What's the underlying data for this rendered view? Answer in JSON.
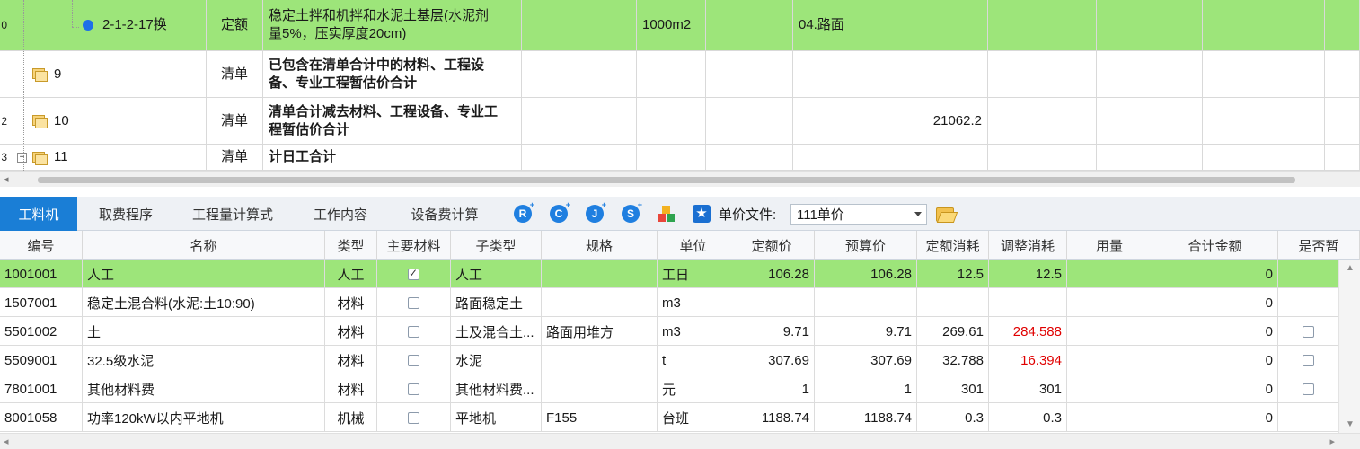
{
  "top_rows": [
    {
      "row_no": "0",
      "code": "2-1-2-17换",
      "type": "定额",
      "name_line1": "稳定土拌和机拌和水泥土基层(水泥剂",
      "name_line2": "量5%，压实厚度20cm)",
      "unit": "1000m2",
      "category": "04.路面",
      "amount": ""
    },
    {
      "row_no": "",
      "code": "9",
      "type": "清单",
      "name_line1": "已包含在清单合计中的材料、工程设",
      "name_line2": "备、专业工程暂估价合计",
      "unit": "",
      "category": "",
      "amount": ""
    },
    {
      "row_no": "2",
      "code": "10",
      "type": "清单",
      "name_line1": "清单合计减去材料、工程设备、专业工",
      "name_line2": "程暂估价合计",
      "unit": "",
      "category": "",
      "amount": "21062.2"
    },
    {
      "row_no": "3",
      "code": "11",
      "type": "清单",
      "name_line1": "计日工合计",
      "name_line2": "",
      "unit": "",
      "category": "",
      "amount": ""
    }
  ],
  "tabs": [
    {
      "label": "工料机",
      "active": true
    },
    {
      "label": "取费程序"
    },
    {
      "label": "工程量计算式"
    },
    {
      "label": "工作内容"
    },
    {
      "label": "设备费计算"
    }
  ],
  "toolbar": {
    "icons": [
      "R",
      "C",
      "J",
      "S"
    ],
    "price_file_label": "单价文件:",
    "price_file_value": "111单价"
  },
  "columns": [
    "编号",
    "名称",
    "类型",
    "主要材料",
    "子类型",
    "规格",
    "单位",
    "定额价",
    "预算价",
    "定额消耗",
    "调整消耗",
    "用量",
    "合计金额",
    "是否暂"
  ],
  "rows": [
    {
      "code": "1001001",
      "name": "人工",
      "type": "人工",
      "main": true,
      "subtype": "人工",
      "spec": "",
      "unit": "工日",
      "quota_price": "106.28",
      "budget_price": "106.28",
      "quota_use": "12.5",
      "adj_use": "12.5",
      "usage": "",
      "total": "0",
      "temp": null,
      "adj_red": false
    },
    {
      "code": "1507001",
      "name": "稳定土混合料(水泥:土10:90)",
      "type": "材料",
      "main": false,
      "subtype": "路面稳定土",
      "spec": "",
      "unit": "m3",
      "quota_price": "",
      "budget_price": "",
      "quota_use": "",
      "adj_use": "",
      "usage": "",
      "total": "0",
      "temp": null,
      "adj_red": false
    },
    {
      "code": "5501002",
      "name": "土",
      "type": "材料",
      "main": false,
      "subtype": "土及混合土...",
      "spec": "路面用堆方",
      "unit": "m3",
      "quota_price": "9.71",
      "budget_price": "9.71",
      "quota_use": "269.61",
      "adj_use": "284.588",
      "usage": "",
      "total": "0",
      "temp": false,
      "adj_red": true
    },
    {
      "code": "5509001",
      "name": "32.5级水泥",
      "type": "材料",
      "main": false,
      "subtype": "水泥",
      "spec": "",
      "unit": "t",
      "quota_price": "307.69",
      "budget_price": "307.69",
      "quota_use": "32.788",
      "adj_use": "16.394",
      "usage": "",
      "total": "0",
      "temp": false,
      "adj_red": true
    },
    {
      "code": "7801001",
      "name": "其他材料费",
      "type": "材料",
      "main": false,
      "subtype": "其他材料费...",
      "spec": "",
      "unit": "元",
      "quota_price": "1",
      "budget_price": "1",
      "quota_use": "301",
      "adj_use": "301",
      "usage": "",
      "total": "0",
      "temp": false,
      "adj_red": false
    },
    {
      "code": "8001058",
      "name": "功率120kW以内平地机",
      "type": "机械",
      "main": false,
      "subtype": "平地机",
      "spec": "F155",
      "unit": "台班",
      "quota_price": "1188.74",
      "budget_price": "1188.74",
      "quota_use": "0.3",
      "adj_use": "0.3",
      "usage": "",
      "total": "0",
      "temp": null,
      "adj_red": false
    }
  ]
}
